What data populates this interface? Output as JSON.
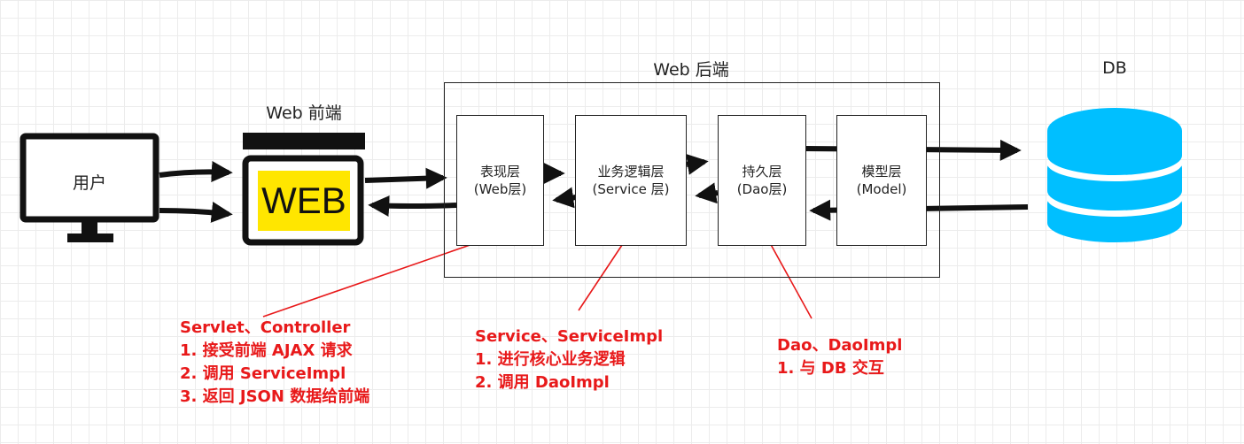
{
  "user": {
    "label": "用户"
  },
  "frontend": {
    "title": "Web 前端",
    "badge": "WEB"
  },
  "backend": {
    "title": "Web 后端",
    "layers": [
      {
        "name": "表现层",
        "sub": "(Web层)"
      },
      {
        "name": "业务逻辑层",
        "sub": "(Service 层)"
      },
      {
        "name": "持久层",
        "sub": "(Dao层)"
      },
      {
        "name": "模型层",
        "sub": "(Model)"
      }
    ]
  },
  "db": {
    "title": "DB"
  },
  "notes": {
    "web": [
      "Servlet、Controller",
      "1. 接受前端 AJAX 请求",
      "2. 调用 ServiceImpl",
      "3. 返回 JSON 数据给前端"
    ],
    "service": [
      "Service、ServiceImpl",
      "1. 进行核心业务逻辑",
      "2. 调用 DaoImpl"
    ],
    "dao": [
      "Dao、DaoImpl",
      "1. 与 DB 交互"
    ]
  },
  "colors": {
    "annotation": "#e8191a",
    "db_fill": "#00bfff",
    "web_badge": "#ffe600",
    "outline": "#111111"
  }
}
